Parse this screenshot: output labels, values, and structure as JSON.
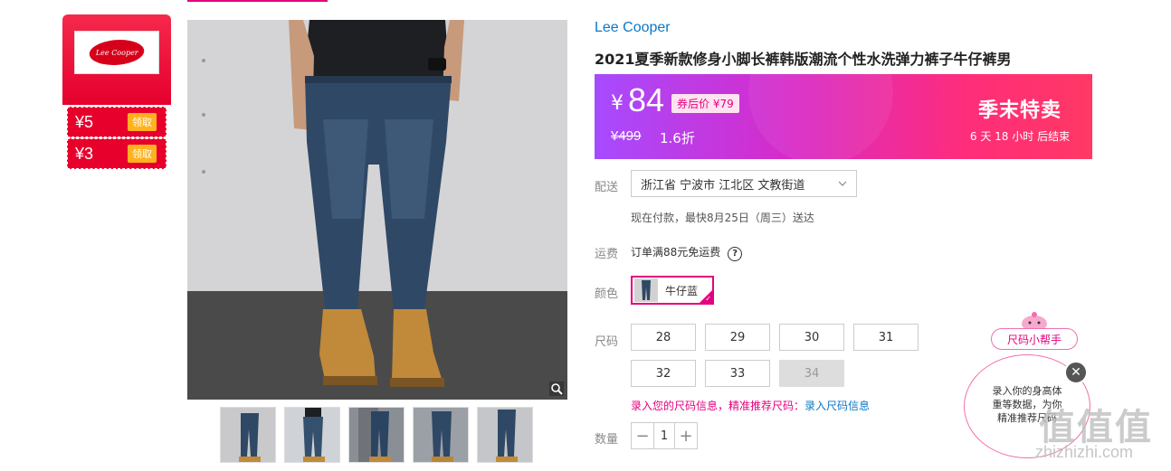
{
  "coupons": {
    "brand_logo_text": "Lee Cooper",
    "items": [
      {
        "amount": "¥5",
        "action": "领取"
      },
      {
        "amount": "¥3",
        "action": "领取"
      }
    ]
  },
  "product": {
    "brand": "Lee Cooper",
    "title": "2021夏季新款修身小脚长裤韩版潮流个性水洗弹力裤子牛仔裤男",
    "thumbnail_count": 5
  },
  "price": {
    "currency": "¥",
    "current": "84",
    "coupon_price": "券后价 ¥79",
    "original": "¥499",
    "discount": "1.6折",
    "promo_title": "季末特卖",
    "promo_time": "6 天 18 小时 后结束"
  },
  "shipping": {
    "label": "配送",
    "address": "浙江省 宁波市 江北区 文教街道",
    "delivery_note": "现在付款，最快8月25日（周三）送达"
  },
  "freight": {
    "label": "运费",
    "text": "订单满88元免运费",
    "help": "?"
  },
  "color": {
    "label": "颜色",
    "selected": "牛仔蓝"
  },
  "size": {
    "label": "尺码",
    "options": [
      "28",
      "29",
      "30",
      "31",
      "32",
      "33",
      "34"
    ],
    "disabled": [
      "34"
    ],
    "hint_prefix": "录入您的尺码信息，精准推荐尺码：",
    "hint_link": "录入尺码信息"
  },
  "quantity": {
    "label": "数量",
    "value": "1",
    "minus": "−",
    "plus": "+"
  },
  "size_helper": {
    "title": "尺码小帮手",
    "message_line1": "录入你的身高体",
    "message_line2": "重等数据，为你",
    "message_line3": "精准推荐尺码",
    "close": "✕"
  },
  "watermark": {
    "main": "值值值",
    "sub": "zhizhizhi.com"
  },
  "colors": {
    "accent": "#e4007f",
    "link": "#0a78c8",
    "coupon_red": "#e8002c"
  }
}
